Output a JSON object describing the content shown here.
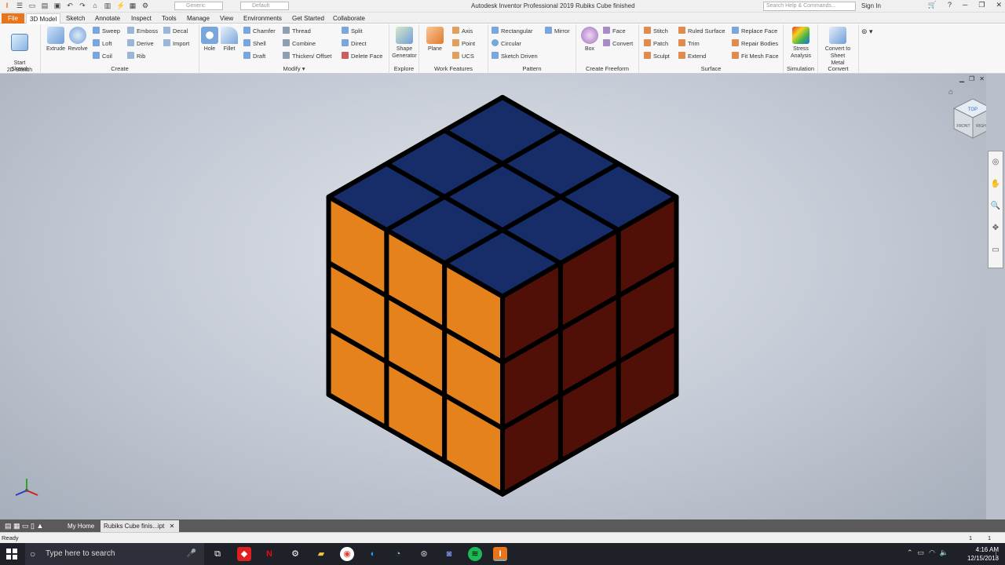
{
  "window": {
    "title": "Autodesk Inventor Professional 2019   Rubiks Cube finished",
    "search_placeholder": "Search Help & Commands...",
    "sign_in": "Sign In",
    "material_dropdown": "Generic",
    "appearance_dropdown": "Default"
  },
  "tabs": [
    "File",
    "3D Model",
    "Sketch",
    "Annotate",
    "Inspect",
    "Tools",
    "Manage",
    "View",
    "Environments",
    "Get Started",
    "Collaborate"
  ],
  "ribbon": {
    "sketch": {
      "title": "Sketch",
      "start": "Start\n2D Sketch"
    },
    "create": {
      "title": "Create",
      "extrude": "Extrude",
      "revolve": "Revolve",
      "sweep": "Sweep",
      "loft": "Loft",
      "coil": "Coil",
      "emboss": "Emboss",
      "derive": "Derive",
      "rib": "Rib",
      "decal": "Decal",
      "import": "Import"
    },
    "modify": {
      "title": "Modify",
      "hole": "Hole",
      "fillet": "Fillet",
      "chamfer": "Chamfer",
      "shell": "Shell",
      "draft": "Draft",
      "thread": "Thread",
      "combine": "Combine",
      "thicken": "Thicken/ Offset",
      "split": "Split",
      "direct": "Direct",
      "delete_face": "Delete Face"
    },
    "explore": {
      "title": "Explore",
      "shape_gen": "Shape Generator"
    },
    "work_features": {
      "title": "Work Features",
      "plane": "Plane",
      "axis": "Axis",
      "point": "Point",
      "ucs": "UCS"
    },
    "pattern": {
      "title": "Pattern",
      "rectangular": "Rectangular",
      "circular": "Circular",
      "sketch_driven": "Sketch Driven",
      "mirror": "Mirror"
    },
    "freeform": {
      "title": "Create Freeform",
      "box": "Box",
      "face": "Face",
      "convert": "Convert"
    },
    "surface": {
      "title": "Surface",
      "stitch": "Stitch",
      "patch": "Patch",
      "sculpt": "Sculpt",
      "ruled": "Ruled Surface",
      "trim": "Trim",
      "extend": "Extend",
      "replace": "Replace Face",
      "repair": "Repair Bodies",
      "fitmesh": "Fit Mesh Face"
    },
    "simulation": {
      "title": "Simulation",
      "stress": "Stress Analysis"
    },
    "convert": {
      "title": "Convert",
      "sheet_metal": "Convert to Sheet Metal"
    }
  },
  "viewcube": {
    "top": "TOP",
    "front": "FRONT",
    "right": "RIGHT"
  },
  "doc_tabs": {
    "home": "My Home",
    "current": "Rubiks Cube finis...ipt"
  },
  "status": {
    "text": "Ready",
    "count1": "1",
    "count2": "1"
  },
  "taskbar": {
    "search": "Type here to search",
    "time": "4:16 AM",
    "date": "12/15/2018"
  },
  "colors": {
    "top": "#172d6a",
    "left": "#e5821c",
    "right": "#501008",
    "edge": "#000000"
  }
}
